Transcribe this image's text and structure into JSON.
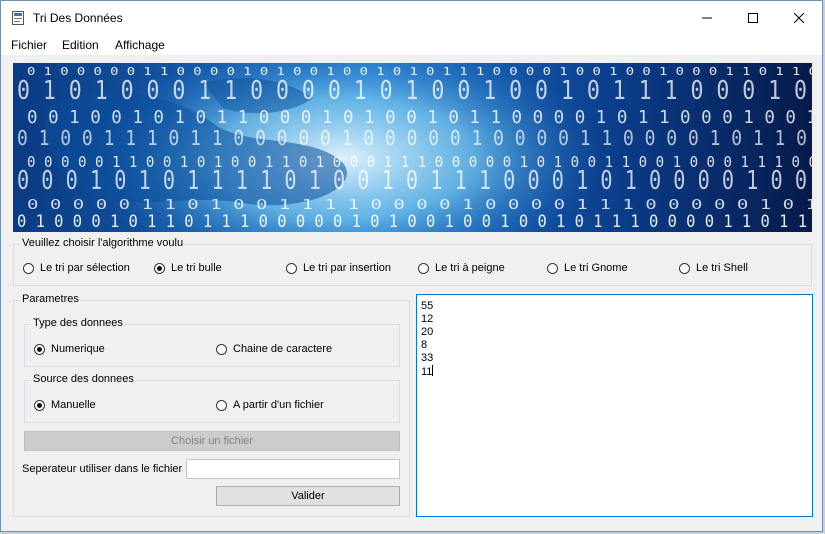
{
  "window": {
    "title": "Tri Des Données"
  },
  "menu": [
    "Fichier",
    "Edition",
    "Affichage"
  ],
  "algorithm": {
    "title": "Veuillez choisir l'algorithme voulu",
    "options": [
      "Le tri par sélection",
      "Le tri bulle",
      "Le tri par insertion",
      "Le tri à peigne",
      "Le tri Gnome",
      "Le tri Shell"
    ],
    "selected": "Le tri bulle"
  },
  "params": {
    "title": "Parametres",
    "type": {
      "title": "Type des donnees",
      "options": [
        "Numerique",
        "Chaine de caractere"
      ],
      "selected": "Numerique"
    },
    "source": {
      "title": "Source des donnees",
      "options": [
        "Manuelle",
        "A partir d'un fichier"
      ],
      "selected": "Manuelle"
    },
    "choose_file_label": "Choisir un fichier",
    "separator_label": "Seperateur utiliser dans le fichier",
    "separator_value": "",
    "validate_label": "Valider"
  },
  "data_lines": [
    "55",
    "12",
    "20",
    "8",
    "33",
    "11"
  ],
  "banner": {
    "rows": [
      "0 1 0 0 0 0 0 1 1 0 0 0 0 1 0 1 0 0 1 0 0 1 0 1 0 1 1 1 0 0 0 0 1 0 0 1 0 0 1 0 0 0 1 1 0 1 1 0",
      "0 1 0 1 0 0 0 1 1 0 0 0 0 1 0 1 0 0 1 0 0 1 0 1 1 1 0 0 0 1 0",
      "0 0 1 0 0 1 0 1 0 1 1 0 0 0 1 0 1 0 0 1 0 1 1 0 0 0 0 1 0 1 1 0 0 0 1 0 0 1",
      "0 1 0 0 1 1 1 0 1 1 0 0 0 0 0 1 0 0 0 0 0 1 0 0 0 0 1 1 0 0 0 0 1 0 1 1 0",
      "0 0 0 0 0 1 1 0 0 1 0 1 0 0 1 1 0 1 0 0 0 1 1 1 0 0 0 0 0 1 0 1 0 0 1 1 0 0 1 0 0 0 1 1 1 0 0",
      "0 0 0 1 0 1 0 1 1 1 1 0 1 0 0 1 0 1 1 1 0 0 0 1 0 1 0 0 0 0 1 0 0",
      "0 0 0 0 0 1 1 0 1 0 0 1 1 1 1 0 0 0 0 1 0 0 0 0 1 1 1 0 0 0 0 0 1 0 1",
      "0 1 0 0 0 1 0 1 1 0 1 1 1 0 0 0 0 0 1 0 1 0 0 1 0 0 1 0 0 1 0 1 1 1 0 0 0 0 1 1 0 1 1"
    ]
  },
  "colors": {
    "accent": "#0078d7",
    "window_border": "#6f8fb8"
  }
}
